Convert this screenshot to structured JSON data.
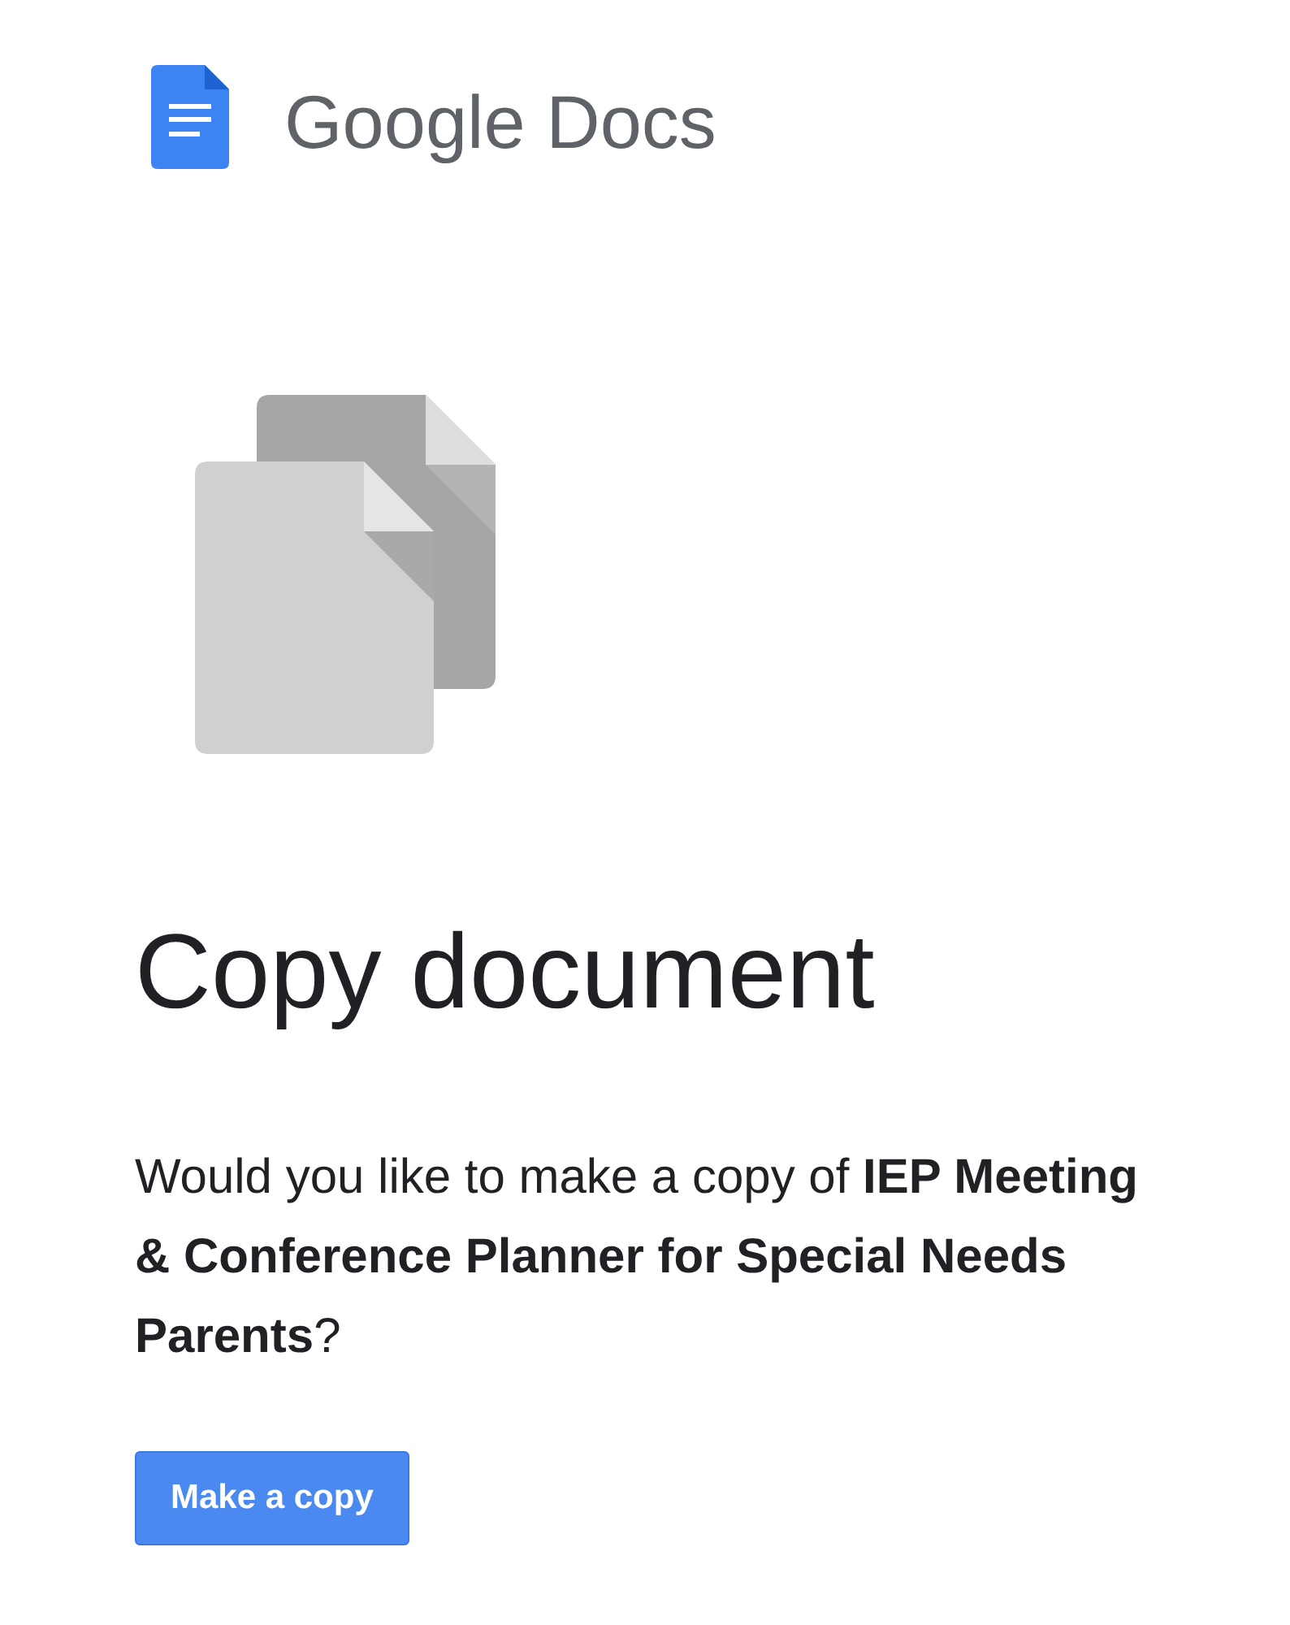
{
  "header": {
    "product_name": "Google Docs"
  },
  "page": {
    "title": "Copy document",
    "prompt": "Would you like to make a copy of **IEP Meeting & Conference Planner for Special Needs Parents**?"
  },
  "button": {
    "label": "Make a copy"
  }
}
